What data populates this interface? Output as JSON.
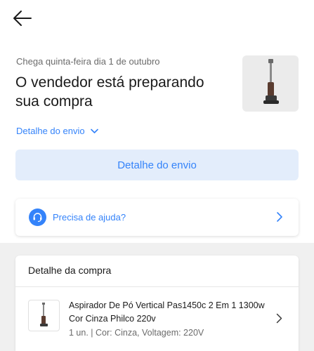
{
  "header": {
    "back_icon": "arrow-left-icon"
  },
  "shipment": {
    "eta": "Chega quinta-feira dia 1 de outubro",
    "headline_line1": "O vendedor está preparando",
    "headline_line2": "sua compra",
    "detail_link": "Detalhe do envio",
    "detail_button": "Detalhe do envio"
  },
  "help": {
    "label": "Precisa de ajuda?",
    "icon": "headset-icon"
  },
  "purchase": {
    "title": "Detalhe da compra",
    "item": {
      "name": "Aspirador De Pó Vertical Pas1450c 2 Em 1 1300w Cor Cinza Philco 220v",
      "meta": "1 un. | Cor: Cinza, Voltagem: 220V"
    }
  },
  "colors": {
    "accent": "#3483fa",
    "accent_light": "#e3edfb",
    "background": "#f0f0f0"
  }
}
